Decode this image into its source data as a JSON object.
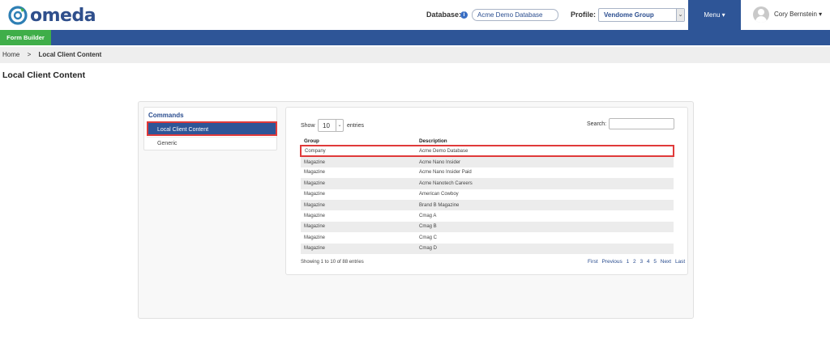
{
  "header": {
    "brand": "omeda",
    "database_label": "Database:",
    "database_value": "Acme Demo Database",
    "profile_label": "Profile:",
    "profile_value": "Vendome Group",
    "menu_label": "Menu ▾",
    "user_name": "Cory Bernstein ▾",
    "icons": [
      "info-icon",
      "chevron-down-icon",
      "user-avatar-icon"
    ],
    "colors": {
      "brand_blue": "#2e5597",
      "brand_green": "#3fae49",
      "highlight_red": "#e03a3a"
    }
  },
  "navbar": {
    "form_builder": "Form Builder"
  },
  "breadcrumb": {
    "home": "Home",
    "separator": ">",
    "current": "Local Client Content"
  },
  "page": {
    "title": "Local Client Content"
  },
  "commands": {
    "title": "Commands",
    "items": [
      {
        "label": "Local Client Content",
        "active": true
      },
      {
        "label": "Generic",
        "active": false
      }
    ]
  },
  "table_controls": {
    "show_label": "Show",
    "page_size": "10",
    "entries_label": "entries",
    "search_label": "Search:"
  },
  "table": {
    "columns": [
      "Group",
      "Description"
    ],
    "rows": [
      [
        "Company",
        "Acme Demo Database"
      ],
      [
        "Magazine",
        "Acme Nano Insider"
      ],
      [
        "Magazine",
        "Acme Nano Insider Paid"
      ],
      [
        "Magazine",
        "Acme Nanotech Careers"
      ],
      [
        "Magazine",
        "American Cowboy"
      ],
      [
        "Magazine",
        "Brand B Magazine"
      ],
      [
        "Magazine",
        "Cmag A"
      ],
      [
        "Magazine",
        "Cmag B"
      ],
      [
        "Magazine",
        "Cmag C"
      ],
      [
        "Magazine",
        "Cmag D"
      ]
    ]
  },
  "footer": {
    "info": "Showing 1 to 10 of 88 entries",
    "pager": [
      "First",
      "Previous",
      "1",
      "2",
      "3",
      "4",
      "5",
      "Next",
      "Last"
    ]
  }
}
